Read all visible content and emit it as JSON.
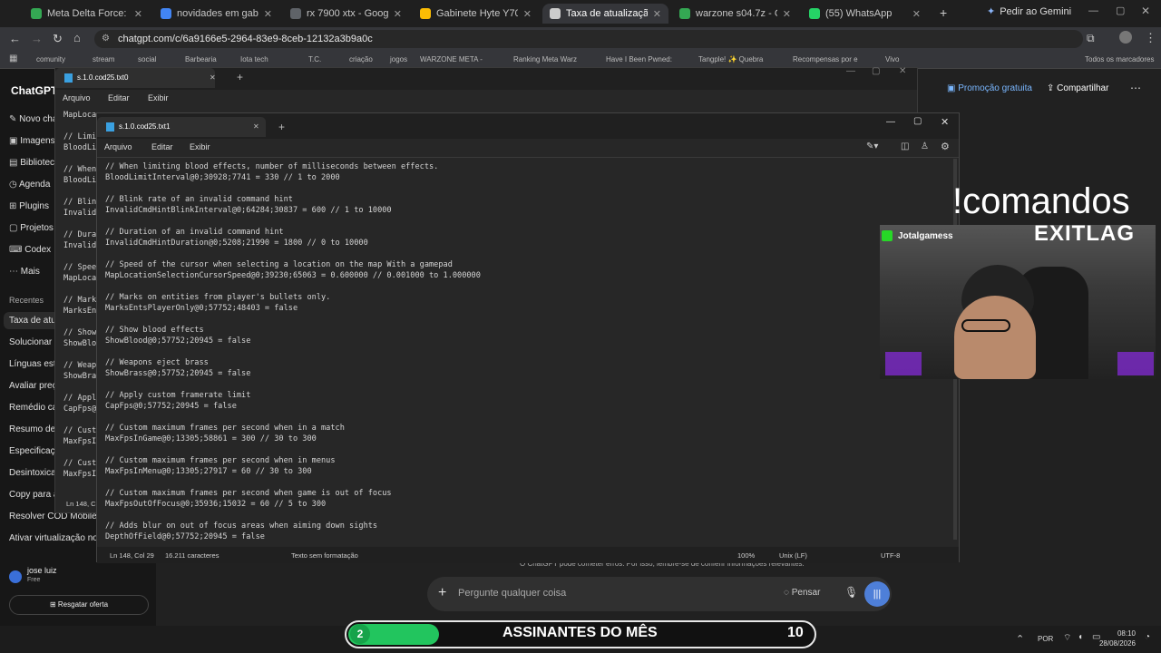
{
  "browser": {
    "tabs": [
      {
        "label": "Meta Delta Force: Melhore",
        "color": "#34a853",
        "active": false
      },
      {
        "label": "novidades em gabinete hig",
        "color": "#4285f4",
        "active": false
      },
      {
        "label": "rx 7900 xtx - Google Shopp",
        "color": "#5f6368",
        "active": false
      },
      {
        "label": "Gabinete Hyte Y70 Touch I",
        "color": "#fbbc04",
        "active": false
      },
      {
        "label": "Taxa de atualização usada",
        "color": "#cccccc",
        "active": true
      },
      {
        "label": "warzone s04.7z - Google D",
        "color": "#34a853",
        "active": false
      },
      {
        "label": "(55) WhatsApp",
        "color": "#25d366",
        "active": false
      }
    ],
    "gemini_label": "Pedir ao Gemini",
    "url": "chatgpt.com/c/6a9166e5-2964-83e9-8ceb-12132a3b9a0c",
    "bookmarks": [
      "comunity",
      "stream",
      "social",
      "Barbearia",
      "Iota tech",
      "T.C.",
      "criação",
      "jogos",
      "WARZONE META -",
      "Ranking Meta Warz",
      "Have I Been Pwned:",
      "Tangple! ✨ Quebra",
      "Recompensas por e",
      "Vivo"
    ],
    "bookmarks_all": "Todos os marcadores"
  },
  "chatgpt": {
    "brand": "ChatGPT",
    "nav": [
      "Novo chat",
      "Imagens",
      "Biblioteca",
      "Agenda",
      "Plugins",
      "Projetos",
      "Codex",
      "Mais"
    ],
    "recents_label": "Recentes",
    "recents": [
      "Taxa de atualização",
      "Solucionar t",
      "Línguas estr",
      "Avaliar preç",
      "Remédio ca",
      "Resumo de",
      "Especificaçõ",
      "Desintoxicaç",
      "Copy para a",
      "Resolver COD Mobile n",
      "Ativar virtualização no C"
    ],
    "user_name": "jose luiz",
    "user_plan": "Free",
    "claim_offer": "Resgatar oferta",
    "promo": "Promoção gratuita",
    "share": "Compartilhar",
    "composer_placeholder": "Pergunte qualquer coisa",
    "think_label": "Pensar",
    "disclaimer": "O ChatGPT pode cometer erros. Por isso, lembre-se de conferir informações relevantes."
  },
  "notepad_back": {
    "tab_title": "s.1.0.cod25.txt0",
    "menu": [
      "Arquivo",
      "Editar",
      "Exibir"
    ],
    "lines": [
      "MapLoca",
      "",
      "// Limi",
      "BloodLi",
      "",
      "// When",
      "BloodLi",
      "",
      "// Blin",
      "Invalid",
      "",
      "// Dura",
      "Invalid",
      "",
      "// Spee",
      "MapLoca",
      "",
      "// Mark",
      "MarksEn",
      "",
      "// Show",
      "ShowBlo",
      "",
      "// Weap",
      "ShowBra",
      "",
      "// Appl",
      "CapFps@",
      "",
      "// Cust",
      "MaxFpsI",
      "",
      "// Cust",
      "MaxFpsI"
    ],
    "status_pos": "Ln 148, C"
  },
  "notepad_front": {
    "tab_title": "s.1.0.cod25.txt1",
    "menu": [
      "Arquivo",
      "Editar",
      "Exibir"
    ],
    "lines": [
      "// When limiting blood effects, number of milliseconds between effects.",
      "BloodLimitInterval@0;30928;7741 = 330 // 1 to 2000",
      "",
      "// Blink rate of an invalid command hint",
      "InvalidCmdHintBlinkInterval@0;64284;30837 = 600 // 1 to 10000",
      "",
      "// Duration of an invalid command hint",
      "InvalidCmdHintDuration@0;5208;21990 = 1800 // 0 to 10000",
      "",
      "// Speed of the cursor when selecting a location on the map With a gamepad",
      "MapLocationSelectionCursorSpeed@0;39230;65063 = 0.600000 // 0.001000 to 1.000000",
      "",
      "// Marks on entities from player's bullets only.",
      "MarksEntsPlayerOnly@0;57752;48403 = false",
      "",
      "// Show blood effects",
      "ShowBlood@0;57752;20945 = false",
      "",
      "// Weapons eject brass",
      "ShowBrass@0;57752;20945 = false",
      "",
      "// Apply custom framerate limit",
      "CapFps@0;57752;20945 = false",
      "",
      "// Custom maximum frames per second when in a match",
      "MaxFpsInGame@0;13305;58861 = 300 // 30 to 300",
      "",
      "// Custom maximum frames per second when in menus",
      "MaxFpsInMenu@0;13305;27917 = 60 // 30 to 300",
      "",
      "// Custom maximum frames per second when game is out of focus",
      "MaxFpsOutOfFocus@0;35936;15032 = 60 // 5 to 300",
      "",
      "// Adds blur on out of focus areas when aiming down sights",
      "DepthOfField@0;57752;20945 = false"
    ],
    "status": {
      "position": "Ln 148, Col 29",
      "chars": "16.211 caracteres",
      "format": "Texto sem formatação",
      "zoom": "100%",
      "eol": "Unix (LF)",
      "encoding": "UTF-8"
    }
  },
  "stream": {
    "commands_text": "!comandos",
    "cam_user": "Jotalgamess",
    "cam_sponsor": "EXITLAG",
    "sub_left_count": "2",
    "sub_title": "ASSINANTES DO MÊS",
    "sub_right_count": "10"
  },
  "taskbar": {
    "search_placeholder": "esquisar",
    "lang": "POR",
    "time": "08:10",
    "date": "28/08/2026"
  }
}
